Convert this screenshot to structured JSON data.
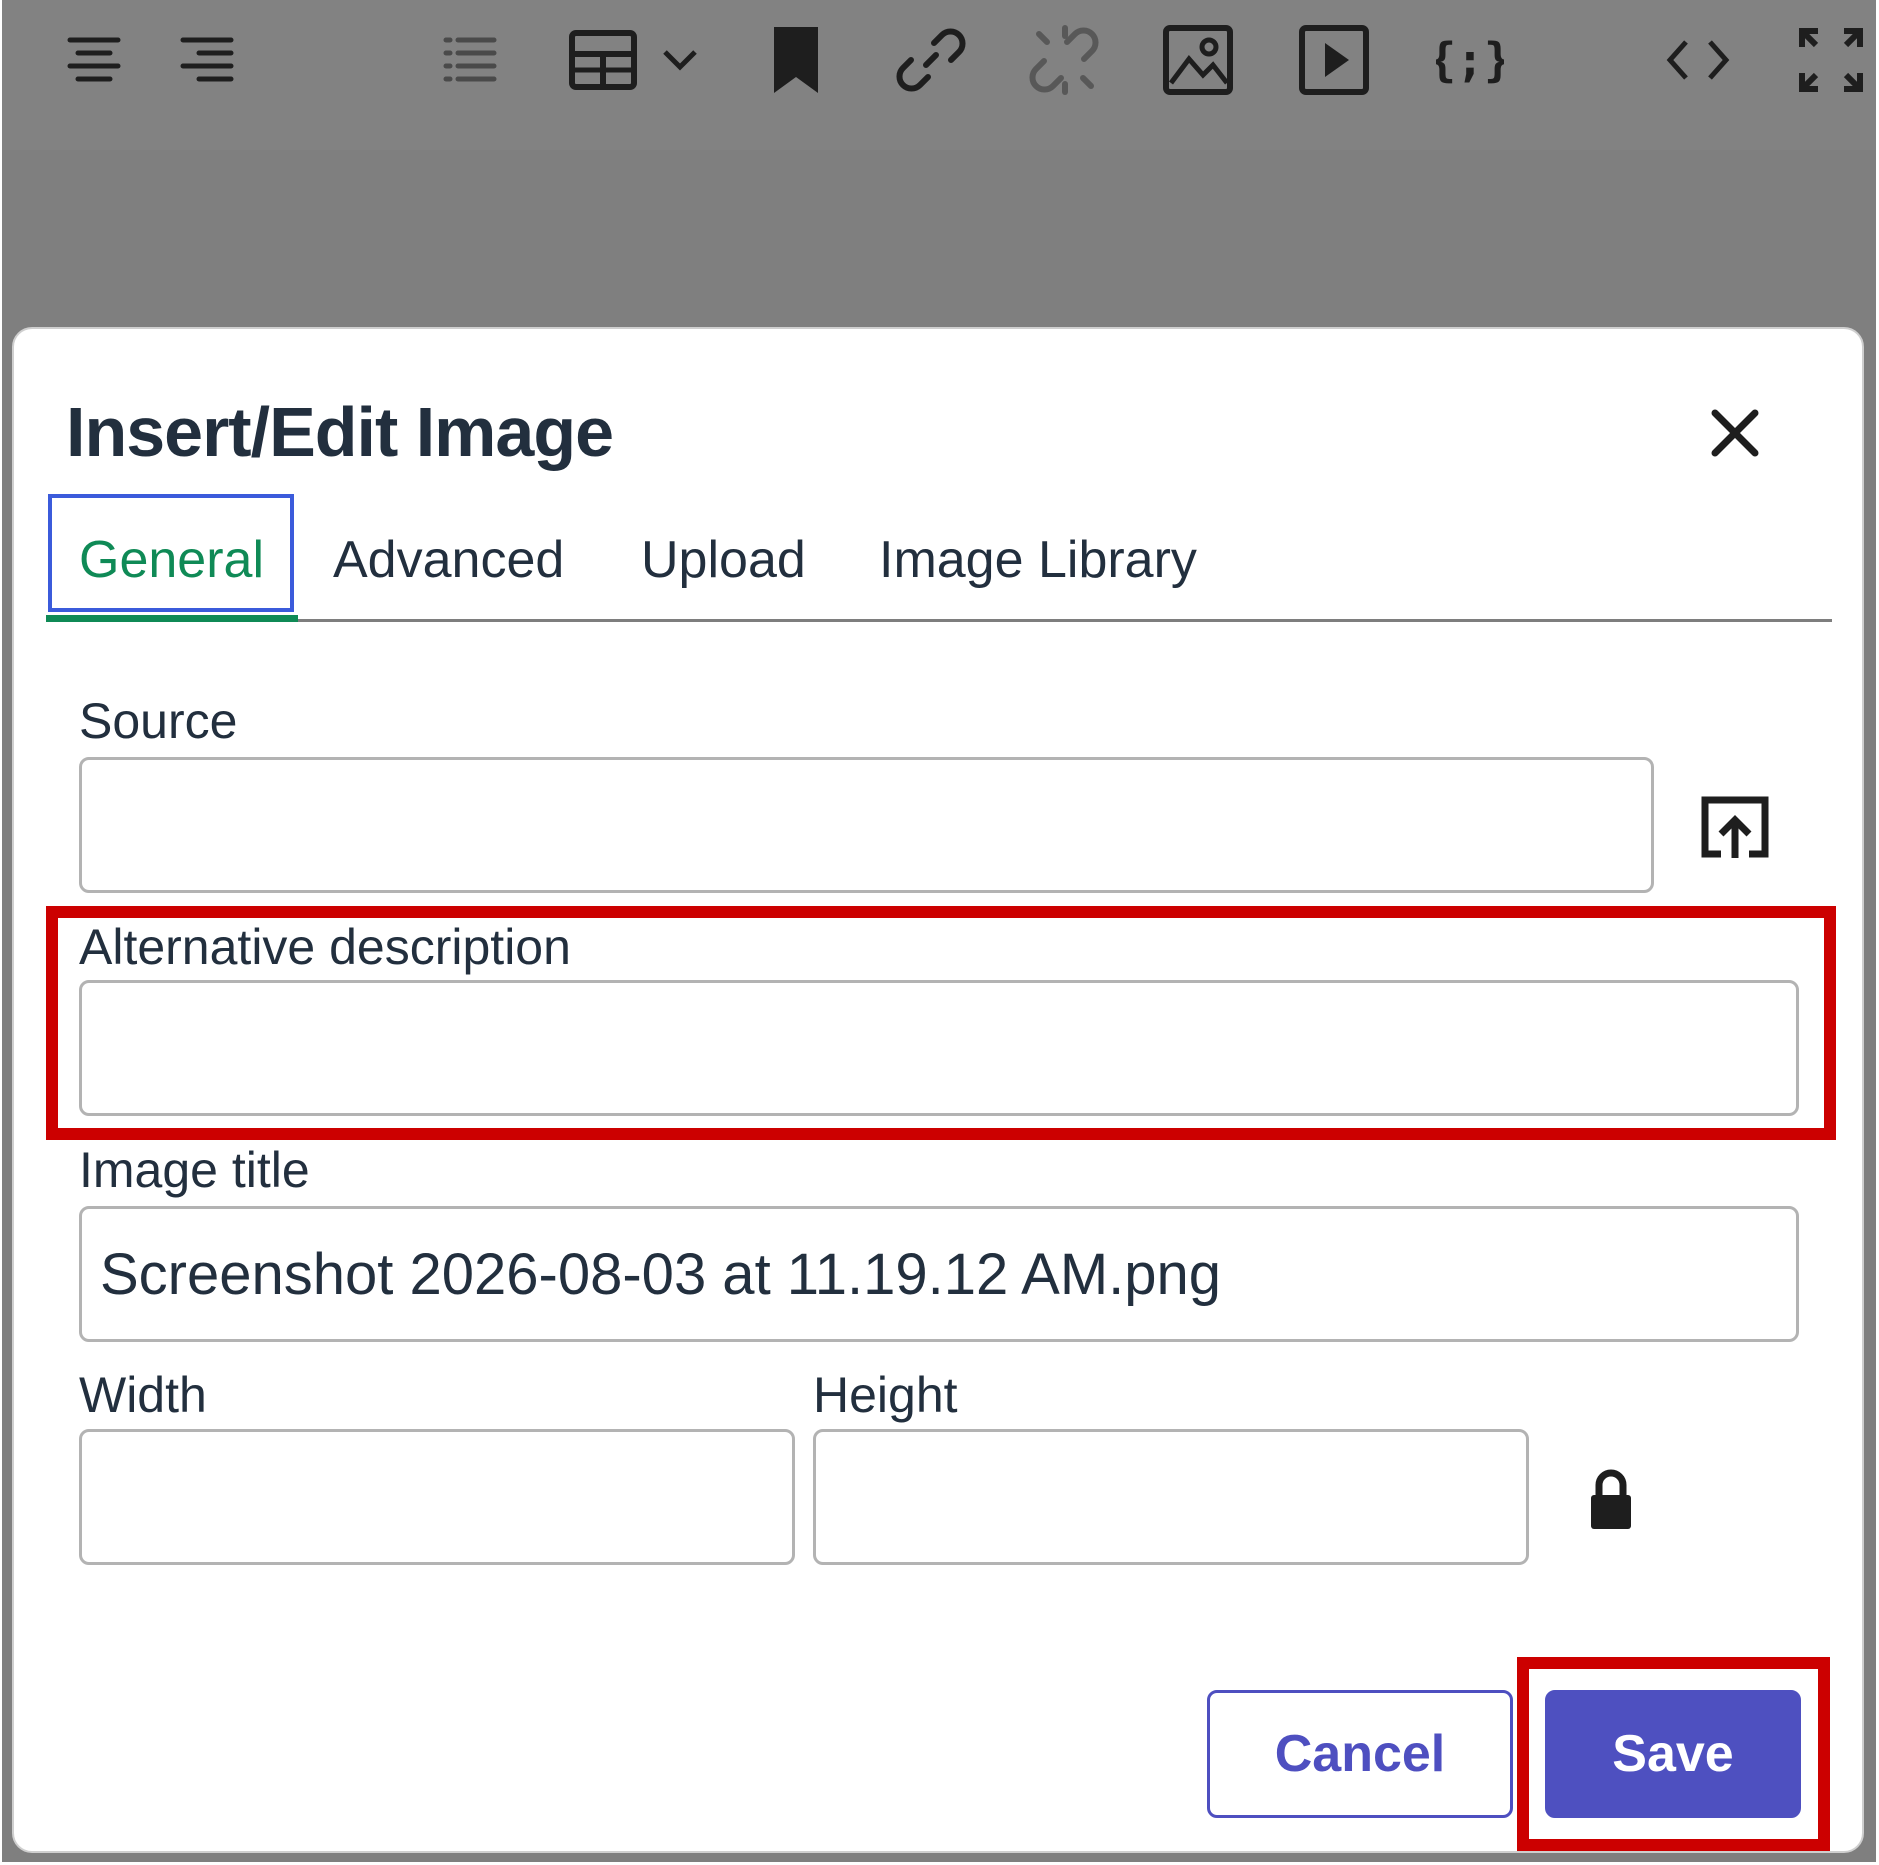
{
  "toolbar": {
    "icons": [
      "align-center-icon",
      "align-right-icon",
      "numbered-list-icon",
      "table-icon",
      "chevron-down-icon",
      "bookmark-icon",
      "link-icon",
      "unlink-icon",
      "image-icon",
      "media-icon",
      "template-icon",
      "source-code-icon",
      "fullscreen-icon"
    ]
  },
  "dialog": {
    "title": "Insert/Edit Image",
    "tabs": [
      {
        "label": "General",
        "active": true
      },
      {
        "label": "Advanced",
        "active": false
      },
      {
        "label": "Upload",
        "active": false
      },
      {
        "label": "Image Library",
        "active": false
      }
    ],
    "fields": {
      "source": {
        "label": "Source",
        "value": ""
      },
      "alt": {
        "label": "Alternative description",
        "value": ""
      },
      "title": {
        "label": "Image title",
        "value": "Screenshot 2026-08-03 at 11.19.12 AM.png"
      },
      "width": {
        "label": "Width",
        "value": ""
      },
      "height": {
        "label": "Height",
        "value": ""
      }
    },
    "buttons": {
      "cancel": "Cancel",
      "save": "Save"
    }
  },
  "colors": {
    "accent": "#4e50c0",
    "active_tab": "#0f8a56",
    "focus": "#3b5bdb",
    "highlight": "#cc0000",
    "overlay": "#7f7f7f"
  }
}
